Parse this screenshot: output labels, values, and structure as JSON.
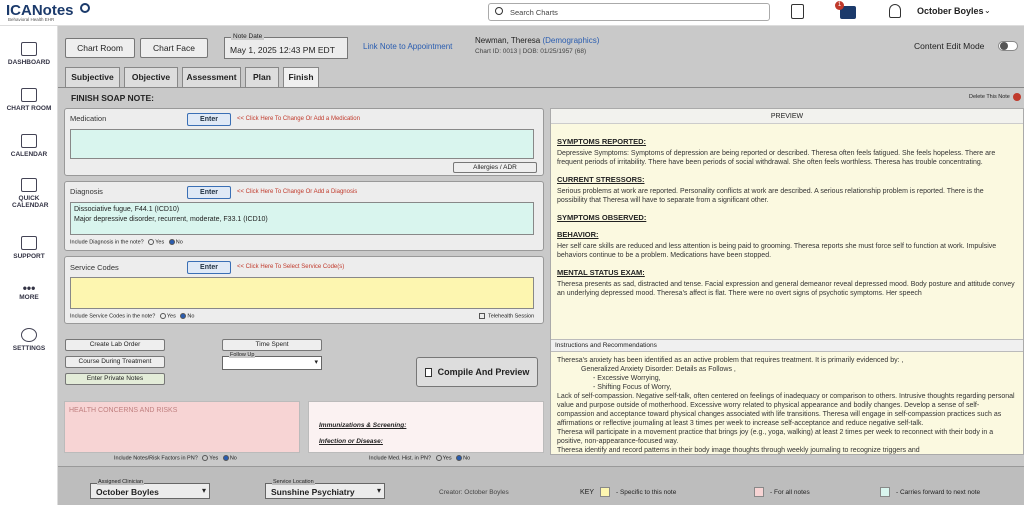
{
  "brand": {
    "name": "ICANotes",
    "tagline": "Behavioral Health EHR"
  },
  "topbar": {
    "search_placeholder": "Search Charts",
    "notification_count": "1",
    "user": "October Boyles"
  },
  "sidebar": [
    {
      "label": "DASHBOARD",
      "icon": "grid-icon"
    },
    {
      "label": "CHART ROOM",
      "icon": "building-icon"
    },
    {
      "label": "CALENDAR",
      "icon": "calendar-icon"
    },
    {
      "label": "QUICK CALENDAR",
      "icon": "quick-calendar-icon"
    },
    {
      "label": "SUPPORT",
      "icon": "chat-icon"
    },
    {
      "label": "MORE",
      "icon": "more-icon"
    },
    {
      "label": "SETTINGS",
      "icon": "gear-icon"
    }
  ],
  "header": {
    "chart_room": "Chart Room",
    "chart_face": "Chart Face",
    "note_date_label": "Note Date",
    "note_date": "May 1, 2025 12:43 PM EDT",
    "link_note": "Link Note to Appointment",
    "patient_name": "Newman, Theresa",
    "demographics": "(Demographics)",
    "chart_info": "Chart ID: 0013 | DOB: 01/25/1957 (68)",
    "content_edit": "Content Edit Mode"
  },
  "tabs": [
    "Subjective",
    "Objective",
    "Assessment",
    "Plan",
    "Finish"
  ],
  "finish_title": "FINISH SOAP NOTE:",
  "medication": {
    "label": "Medication",
    "enter": "Enter",
    "hint": "<< Click Here To Change Or Add a Medication",
    "allergies": "Allergies / ADR"
  },
  "diagnosis": {
    "label": "Diagnosis",
    "enter": "Enter",
    "hint": "<< Click Here To Change Or Add a Diagnosis",
    "lines": [
      "Dissociative fugue, F44.1 (ICD10)",
      "Major depressive disorder, recurrent, moderate, F33.1 (ICD10)"
    ],
    "include": "Include Diagnosis in the note?",
    "yes": "Yes",
    "no": "No"
  },
  "service": {
    "label": "Service Codes",
    "enter": "Enter",
    "hint": "<< Click Here To Select Service Code(s)",
    "include": "Include Service Codes in the note?",
    "yes": "Yes",
    "no": "No",
    "telehealth": "Telehealth Session"
  },
  "actions": {
    "lab": "Create Lab Order",
    "course": "Course During Treatment",
    "private": "Enter Private Notes",
    "time": "Time Spent",
    "followup": "Follow Up",
    "compile": "Compile And Preview"
  },
  "health": {
    "title": "HEALTH CONCERNS AND RISKS",
    "include": "Include Notes/Risk Factors in PN?",
    "yes": "Yes",
    "no": "No"
  },
  "immun": {
    "immunizations": "Immunizations & Screening:",
    "infection": "Infection or Disease:",
    "include": "Include Med. Hist. in PN?",
    "yes": "Yes",
    "no": "No"
  },
  "preview": {
    "delete": "Delete This Note",
    "title": "PREVIEW",
    "s1": "SYMPTOMS REPORTED:",
    "s1_text": "Depressive Symptoms: Symptoms of depression are being reported or described. Theresa often feels fatigued. She feels hopeless. There are frequent periods of irritability. There have been periods of social withdrawal. She often feels worthless. Theresa has trouble concentrating.",
    "s2": "CURRENT STRESSORS:",
    "s2_text": "Serious problems at work are reported. Personality conflicts at work are described. A serious relationship problem is reported. There is the possibility that Theresa will have to separate from a significant other.",
    "s3": "SYMPTOMS OBSERVED:",
    "s4": "BEHAVIOR:",
    "s4_text": "Her self care skills are reduced and less attention is being paid to grooming. Theresa reports she must force self to function at work. Impulsive behaviors continue to be a problem. Medications have been stopped.",
    "s5": "MENTAL STATUS EXAM:",
    "s5_text": "Theresa presents as sad, distracted and tense. Facial expression and general demeanor reveal depressed mood. Body posture and attitude convey an underlying depressed mood. Theresa's affect is flat. There were no overt signs of psychotic symptoms. Her speech",
    "instr": "Instructions and Recommendations",
    "i1": "Theresa's anxiety has been identified as an active problem that requires treatment. It is primarily evidenced by: ,",
    "i2": "Generalized Anxiety Disorder: Details as Follows ,",
    "i3": "- Excessive  Worrying,",
    "i4": "- Shifting Focus of Worry,",
    "i5": "Lack of self-compassion. Negative self-talk, often centered on feelings of inadequacy or comparison to others. Intrusive thoughts regarding personal value and purpose outside of motherhood. Excessive worry related to physical appearance and bodily changes. Develop a sense of self-compassion and acceptance toward physical changes associated with life transitions. Theresa will engage in self-compassion practices such as affirmations or reflective journaling at least 3 times per week to increase self-acceptance and reduce negative self-talk.",
    "i6": "Theresa will participate in a movement practice that brings joy (e.g., yoga, walking) at least 2 times per week to reconnect with their body in a positive, non-appearance-focused way.",
    "i7": "Theresa identify and record patterns in their body image thoughts through weekly journaling to recognize triggers and"
  },
  "footer": {
    "clinician_label": "Assigned Clinician",
    "clinician": "October Boyles",
    "location_label": "Service Location",
    "location": "Sunshine Psychiatry",
    "creator": "Creator: October Boyles",
    "key": "KEY",
    "k1": "- Specific to this note",
    "k2": "- For all notes",
    "k3": "- Carries forward to next note"
  },
  "colors": {
    "yellow": "#fdf6b0",
    "pink": "#f7d4d4",
    "teal": "#d9f5ee",
    "preview_bg": "#fbf9e0"
  }
}
